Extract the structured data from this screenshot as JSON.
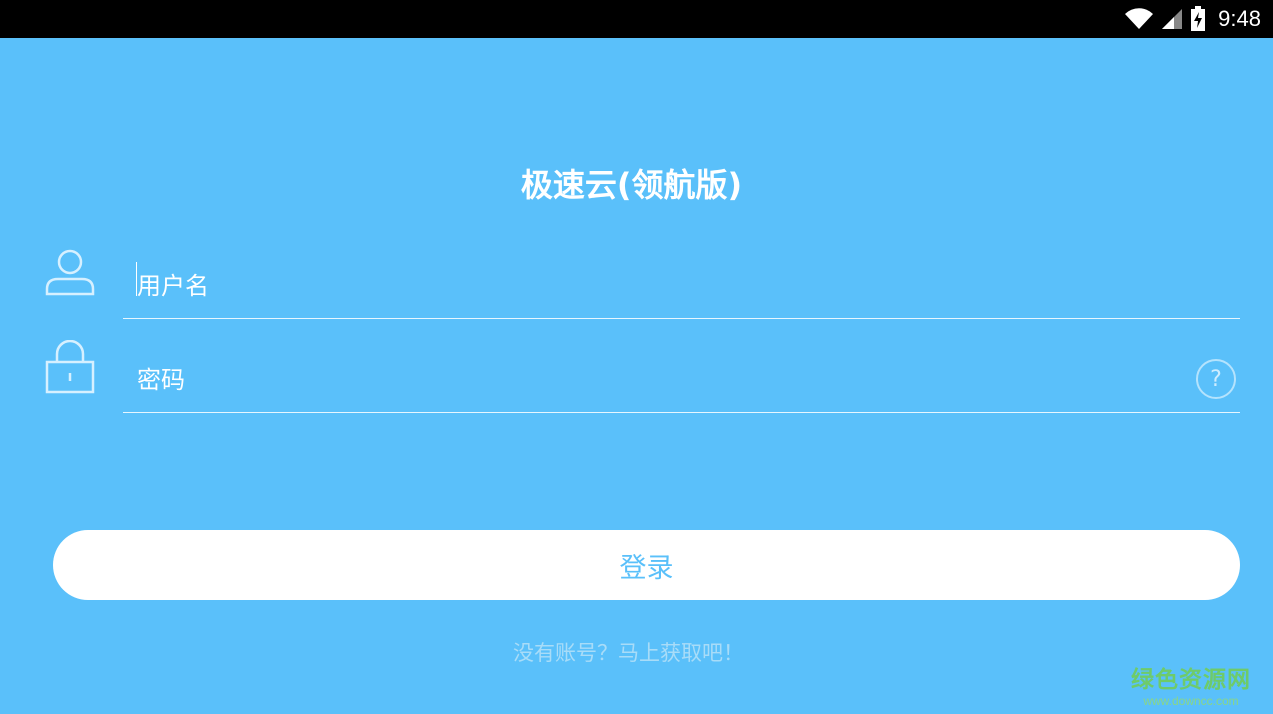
{
  "status_bar": {
    "time": "9:48",
    "icons": [
      "wifi-icon",
      "signal-icon",
      "battery-charging-icon"
    ]
  },
  "app": {
    "title": "极速云(领航版)"
  },
  "form": {
    "username_placeholder": "用户名",
    "username_value": "",
    "password_placeholder": "密码",
    "password_value": "",
    "help_label": "?"
  },
  "login_button": {
    "label": "登录"
  },
  "register_link": {
    "label": "没有账号？马上获取吧！"
  },
  "watermark": {
    "main": "绿色资源网",
    "sub": "www.downcc.com"
  },
  "colors": {
    "background": "#5ac0fa",
    "button_bg": "#ffffff",
    "button_text": "#5ac0fa",
    "status_bar": "#000000"
  }
}
